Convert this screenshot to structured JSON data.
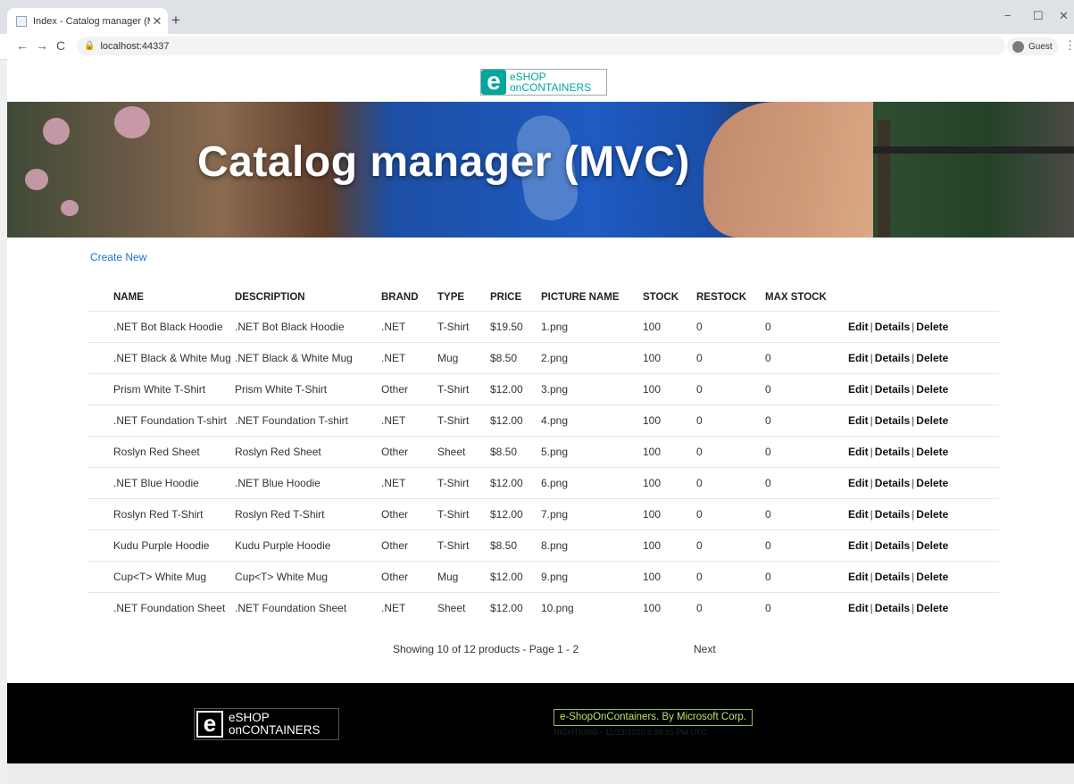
{
  "browser": {
    "tab_title": "Index - Catalog manager (MVC)",
    "tab_close": "✕",
    "new_tab": "+",
    "url": "localhost:44337",
    "profile_label": "Guest",
    "back": "←",
    "forward": "→",
    "reload": "C",
    "menu": "⋮",
    "min": "−",
    "max": "☐",
    "close": "✕"
  },
  "header": {
    "logo_e": "e",
    "logo_line1": "eSHOP",
    "logo_line2": "onCONTAINERS"
  },
  "hero": {
    "title": "Catalog manager (MVC)"
  },
  "actions": {
    "create_new": "Create New",
    "edit": "Edit",
    "details": "Details",
    "delete": "Delete",
    "sep": "|"
  },
  "table": {
    "headers": [
      "NAME",
      "DESCRIPTION",
      "BRAND",
      "TYPE",
      "PRICE",
      "PICTURE NAME",
      "STOCK",
      "RESTOCK",
      "MAX STOCK"
    ],
    "rows": [
      [
        ".NET Bot Black Hoodie",
        ".NET Bot Black Hoodie",
        ".NET",
        "T-Shirt",
        "$19.50",
        "1.png",
        "100",
        "0",
        "0"
      ],
      [
        ".NET Black & White Mug",
        ".NET Black & White Mug",
        ".NET",
        "Mug",
        "$8.50",
        "2.png",
        "100",
        "0",
        "0"
      ],
      [
        "Prism White T-Shirt",
        "Prism White T-Shirt",
        "Other",
        "T-Shirt",
        "$12.00",
        "3.png",
        "100",
        "0",
        "0"
      ],
      [
        ".NET Foundation T-shirt",
        ".NET Foundation T-shirt",
        ".NET",
        "T-Shirt",
        "$12.00",
        "4.png",
        "100",
        "0",
        "0"
      ],
      [
        "Roslyn Red Sheet",
        "Roslyn Red Sheet",
        "Other",
        "Sheet",
        "$8.50",
        "5.png",
        "100",
        "0",
        "0"
      ],
      [
        ".NET Blue Hoodie",
        ".NET Blue Hoodie",
        ".NET",
        "T-Shirt",
        "$12.00",
        "6.png",
        "100",
        "0",
        "0"
      ],
      [
        "Roslyn Red T-Shirt",
        "Roslyn Red T-Shirt",
        "Other",
        "T-Shirt",
        "$12.00",
        "7.png",
        "100",
        "0",
        "0"
      ],
      [
        "Kudu Purple Hoodie",
        "Kudu Purple Hoodie",
        "Other",
        "T-Shirt",
        "$8.50",
        "8.png",
        "100",
        "0",
        "0"
      ],
      [
        "Cup<T> White Mug",
        "Cup<T> White Mug",
        "Other",
        "Mug",
        "$12.00",
        "9.png",
        "100",
        "0",
        "0"
      ],
      [
        ".NET Foundation Sheet",
        ".NET Foundation Sheet",
        ".NET",
        "Sheet",
        "$12.00",
        "10.png",
        "100",
        "0",
        "0"
      ]
    ]
  },
  "pager": {
    "status": "Showing 10 of 12 products - Page 1 - 2",
    "next": "Next"
  },
  "footer": {
    "logo_e": "e",
    "logo_line1": "eSHOP",
    "logo_line2": "onCONTAINERS",
    "brand": "e-ShopOnContainers. By Microsoft Corp.",
    "build": "NIGHTKING - 11/23/2020 5:38:35 PM UTC"
  },
  "colors": {
    "accent": "#00a69c",
    "link": "#1a73d0",
    "footer_bg": "#000000",
    "footer_brand": "#b7e36b"
  }
}
